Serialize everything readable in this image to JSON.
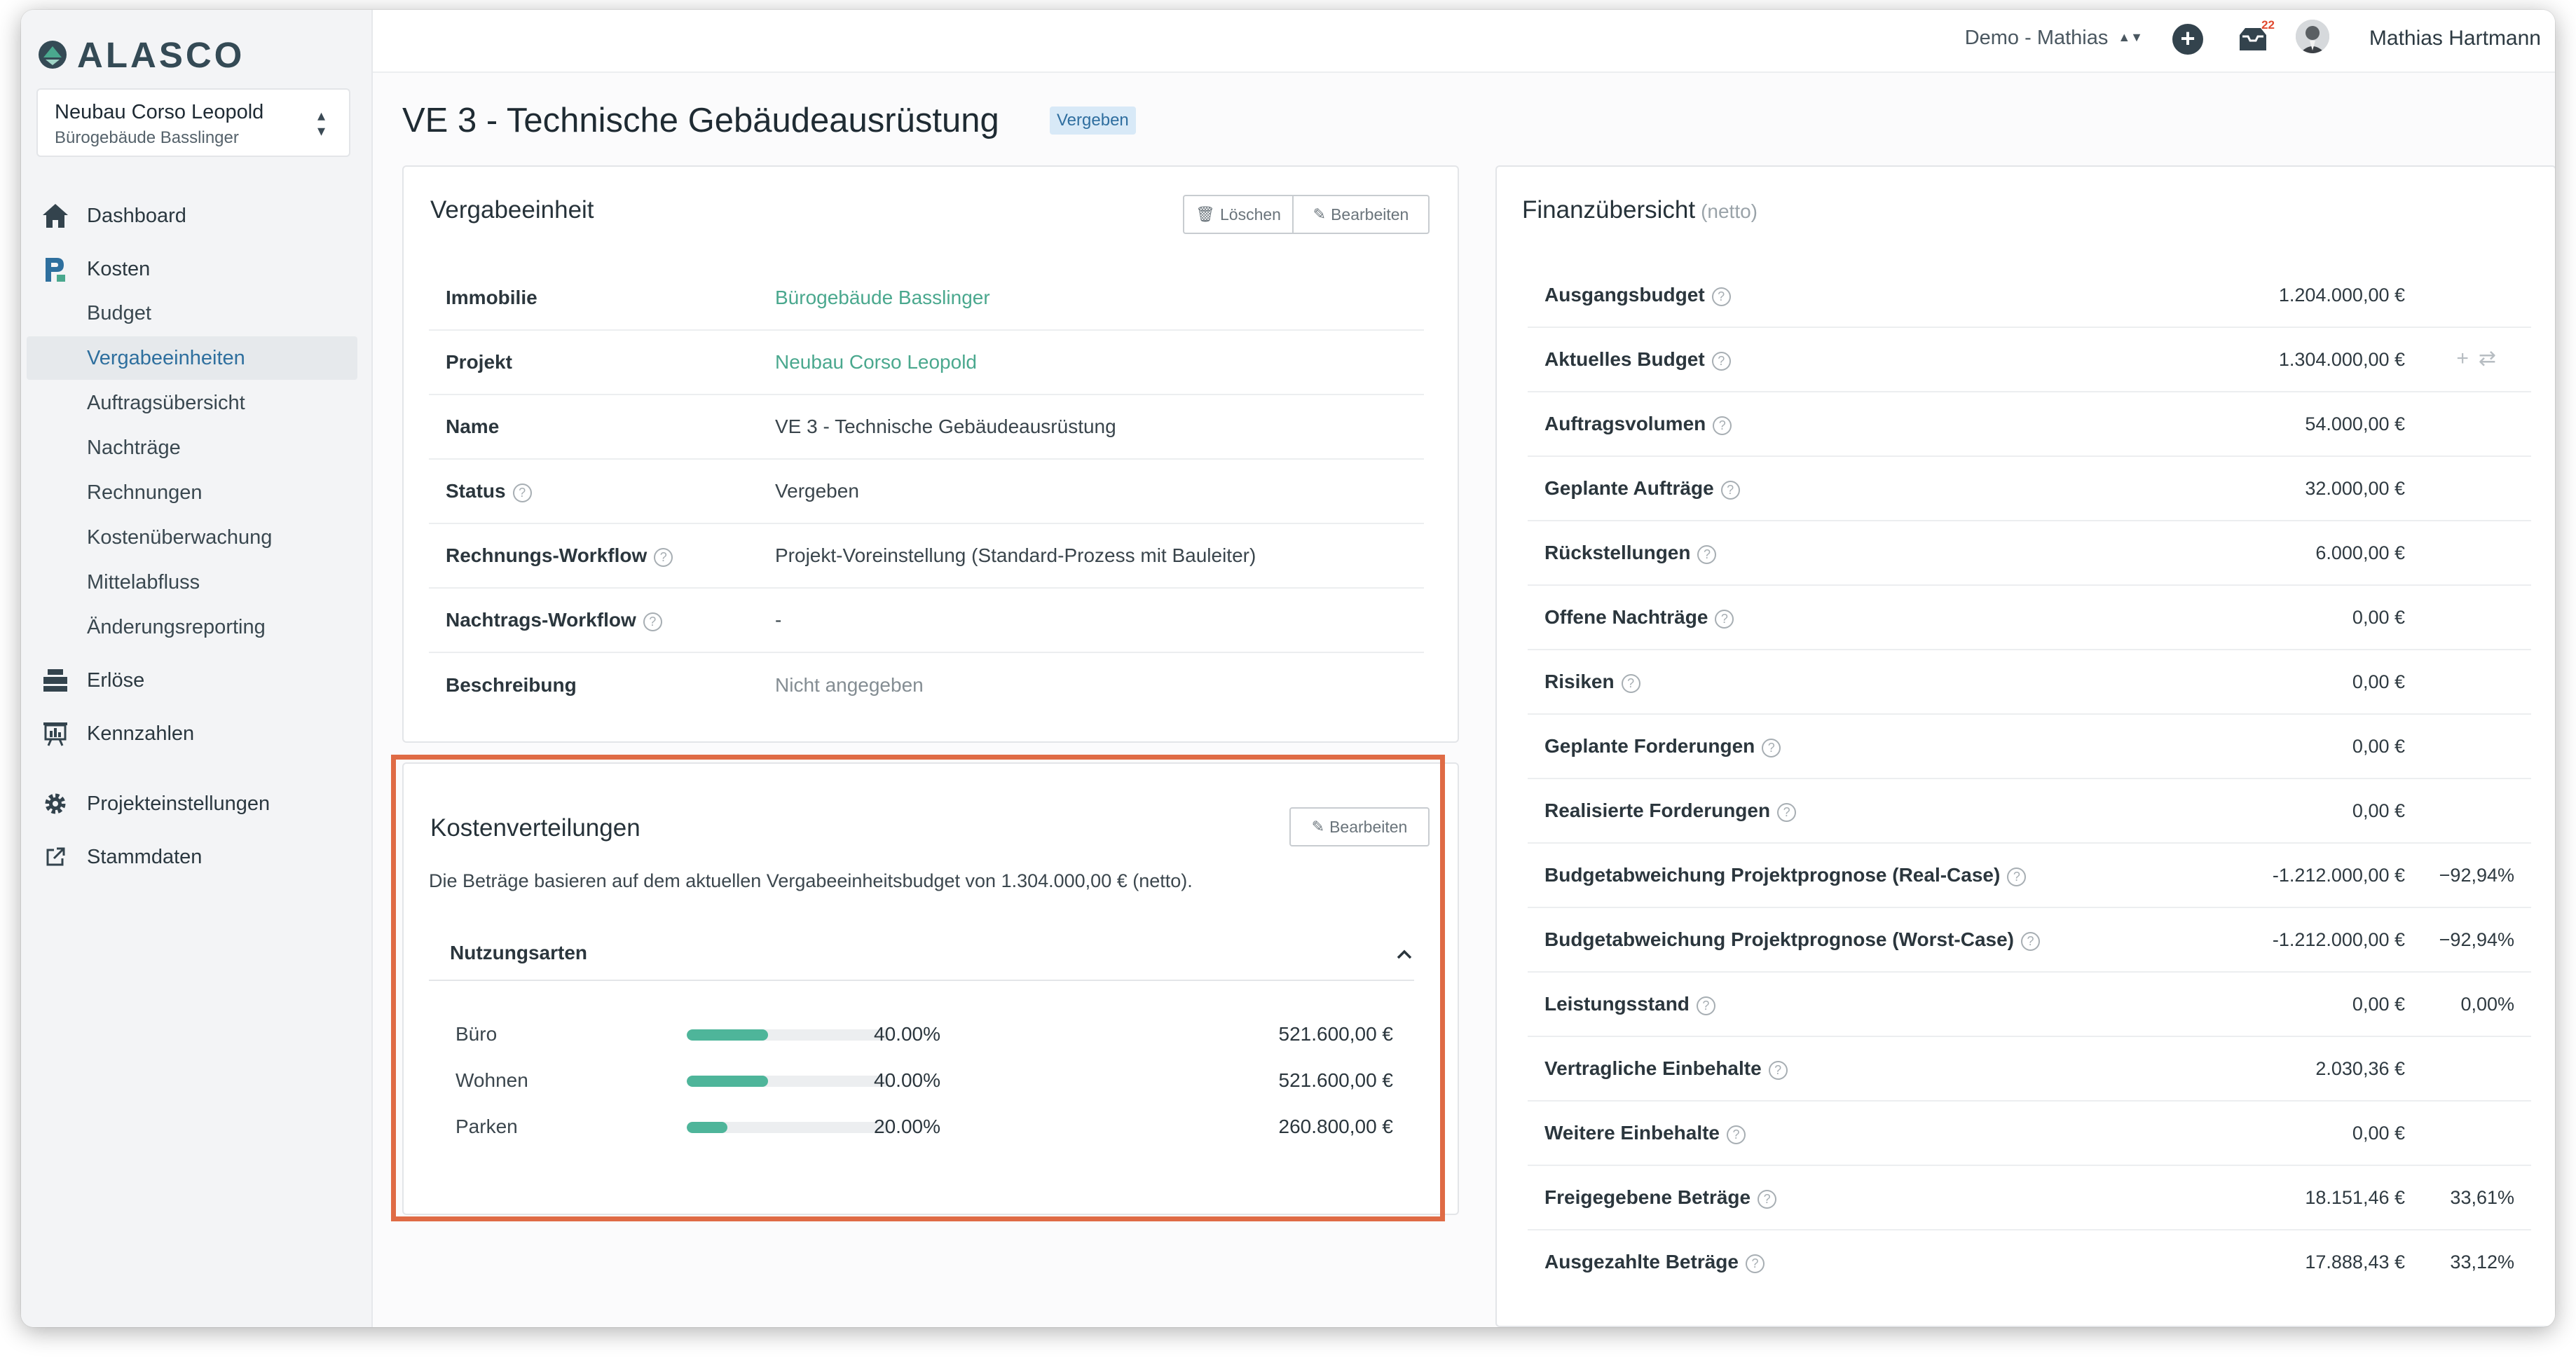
{
  "brand": {
    "name": "ALASCO",
    "accent": "#4aa88e",
    "highlight": "#df6b45"
  },
  "project": {
    "name": "Neubau Corso Leopold",
    "building": "Bürogebäude Basslinger"
  },
  "nav": {
    "dashboard": {
      "label": "Dashboard",
      "icon": "home-icon"
    },
    "kosten": {
      "label": "Kosten",
      "icon": "kosten-icon"
    },
    "kosten_items": [
      "Budget",
      "Vergabeeinheiten",
      "Auftragsübersicht",
      "Nachträge",
      "Rechnungen",
      "Kostenüberwachung",
      "Mittelabfluss",
      "Änderungsreporting"
    ],
    "erloese": {
      "label": "Erlöse",
      "icon": "cash-register-icon"
    },
    "kennzahlen": {
      "label": "Kennzahlen",
      "icon": "presentation-chart-icon"
    },
    "projekteinstellungen": {
      "label": "Projekteinstellungen",
      "icon": "gear-icon"
    },
    "stammdaten": {
      "label": "Stammdaten",
      "icon": "external-link-icon"
    }
  },
  "topbar": {
    "workspace": "Demo - Mathias",
    "notifications": "22",
    "user": "Mathias Hartmann"
  },
  "page": {
    "title": "VE 3 - Technische Gebäudeausrüstung",
    "status_badge": "Vergeben"
  },
  "vergabeeinheit": {
    "title": "Vergabeeinheit",
    "delete_label": "Löschen",
    "edit_label": "Bearbeiten",
    "rows": [
      {
        "label": "Immobilie",
        "value": "Bürogebäude Basslinger"
      },
      {
        "label": "Projekt",
        "value": "Neubau Corso Leopold"
      },
      {
        "label": "Name",
        "value": "VE 3 - Technische Gebäudeausrüstung"
      },
      {
        "label": "Status",
        "value": "Vergeben"
      },
      {
        "label": "Rechnungs-Workflow",
        "value": "Projekt-Voreinstellung (Standard-Prozess mit Bauleiter)"
      },
      {
        "label": "Nachtrags-Workflow",
        "value": "-"
      },
      {
        "label": "Beschreibung",
        "value": "Nicht angegeben"
      }
    ]
  },
  "kostenverteilungen": {
    "title": "Kostenverteilungen",
    "edit_label": "Bearbeiten",
    "note": "Die Beträge basieren auf dem aktuellen Vergabeeinheitsbudget von 1.304.000,00 € (netto).",
    "section": "Nutzungsarten",
    "items": [
      {
        "name": "Büro",
        "percent": "40.00%",
        "fraction": 0.4,
        "amount": "521.600,00 €"
      },
      {
        "name": "Wohnen",
        "percent": "40.00%",
        "fraction": 0.4,
        "amount": "521.600,00 €"
      },
      {
        "name": "Parken",
        "percent": "20.00%",
        "fraction": 0.2,
        "amount": "260.800,00 €"
      }
    ]
  },
  "finanz": {
    "title": "Finanzübersicht",
    "subtitle": "(netto)",
    "rows": [
      {
        "label": "Ausgangsbudget",
        "value": "1.204.000,00 €",
        "pct": ""
      },
      {
        "label": "Aktuelles Budget",
        "value": "1.304.000,00 €",
        "pct": ""
      },
      {
        "label": "Auftragsvolumen",
        "value": "54.000,00 €",
        "pct": ""
      },
      {
        "label": "Geplante Aufträge",
        "value": "32.000,00 €",
        "pct": ""
      },
      {
        "label": "Rückstellungen",
        "value": "6.000,00 €",
        "pct": ""
      },
      {
        "label": "Offene Nachträge",
        "value": "0,00 €",
        "pct": ""
      },
      {
        "label": "Risiken",
        "value": "0,00 €",
        "pct": ""
      },
      {
        "label": "Geplante Forderungen",
        "value": "0,00 €",
        "pct": ""
      },
      {
        "label": "Realisierte Forderungen",
        "value": "0,00 €",
        "pct": ""
      },
      {
        "label": "Budgetabweichung Projektprognose (Real-Case)",
        "value": "-1.212.000,00 €",
        "pct": "−92,94%"
      },
      {
        "label": "Budgetabweichung Projektprognose (Worst-Case)",
        "value": "-1.212.000,00 €",
        "pct": "−92,94%"
      },
      {
        "label": "Leistungsstand",
        "value": "0,00 €",
        "pct": "0,00%"
      },
      {
        "label": "Vertragliche Einbehalte",
        "value": "2.030,36 €",
        "pct": ""
      },
      {
        "label": "Weitere Einbehalte",
        "value": "0,00 €",
        "pct": ""
      },
      {
        "label": "Freigegebene Beträge",
        "value": "18.151,46 €",
        "pct": "33,61%"
      },
      {
        "label": "Ausgezahlte Beträge",
        "value": "17.888,43 €",
        "pct": "33,12%"
      }
    ]
  }
}
